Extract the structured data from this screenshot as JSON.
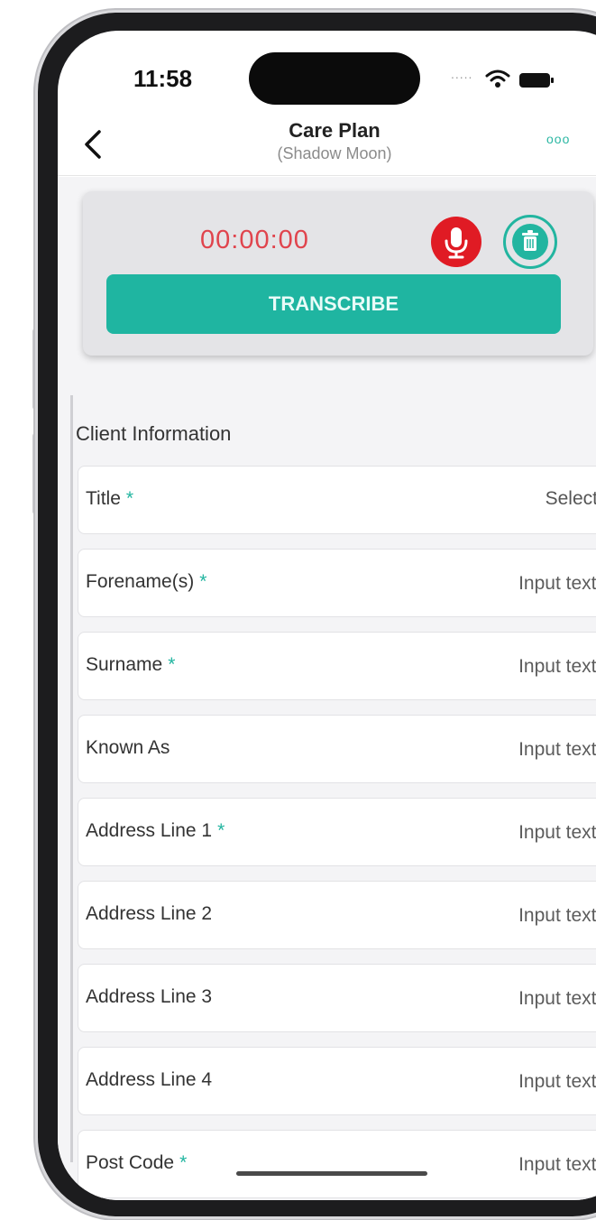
{
  "status_bar": {
    "time": "11:58",
    "signal_dots": "....."
  },
  "nav": {
    "title": "Care Plan",
    "subtitle": "(Shadow Moon)",
    "more_label": "ooo"
  },
  "recorder": {
    "timer": "00:00:00",
    "transcribe_label": "TRANSCRIBE"
  },
  "form": {
    "section_title": "Client Information",
    "required_marker": "*",
    "title_field": {
      "label": "Title",
      "required": true,
      "value": "Select"
    },
    "fields": [
      {
        "label": "Forename(s)",
        "required": true,
        "placeholder": "Input text..."
      },
      {
        "label": "Surname",
        "required": true,
        "placeholder": "Input text..."
      },
      {
        "label": "Known As",
        "required": false,
        "placeholder": "Input text..."
      },
      {
        "label": "Address Line 1",
        "required": true,
        "placeholder": "Input text..."
      },
      {
        "label": "Address Line 2",
        "required": false,
        "placeholder": "Input text..."
      },
      {
        "label": "Address Line 3",
        "required": false,
        "placeholder": "Input text..."
      },
      {
        "label": "Address Line 4",
        "required": false,
        "placeholder": "Input text..."
      },
      {
        "label": "Post Code",
        "required": true,
        "placeholder": "Input text..."
      }
    ]
  },
  "colors": {
    "accent": "#1fb5a1",
    "timer_red": "#e0444d",
    "mic_red": "#e01b24"
  },
  "icons": {
    "back": "chevron-left-icon",
    "mic": "microphone-icon",
    "trash": "trash-icon",
    "wifi": "wifi-icon",
    "battery": "battery-icon",
    "select": "chevron-down-icon"
  }
}
